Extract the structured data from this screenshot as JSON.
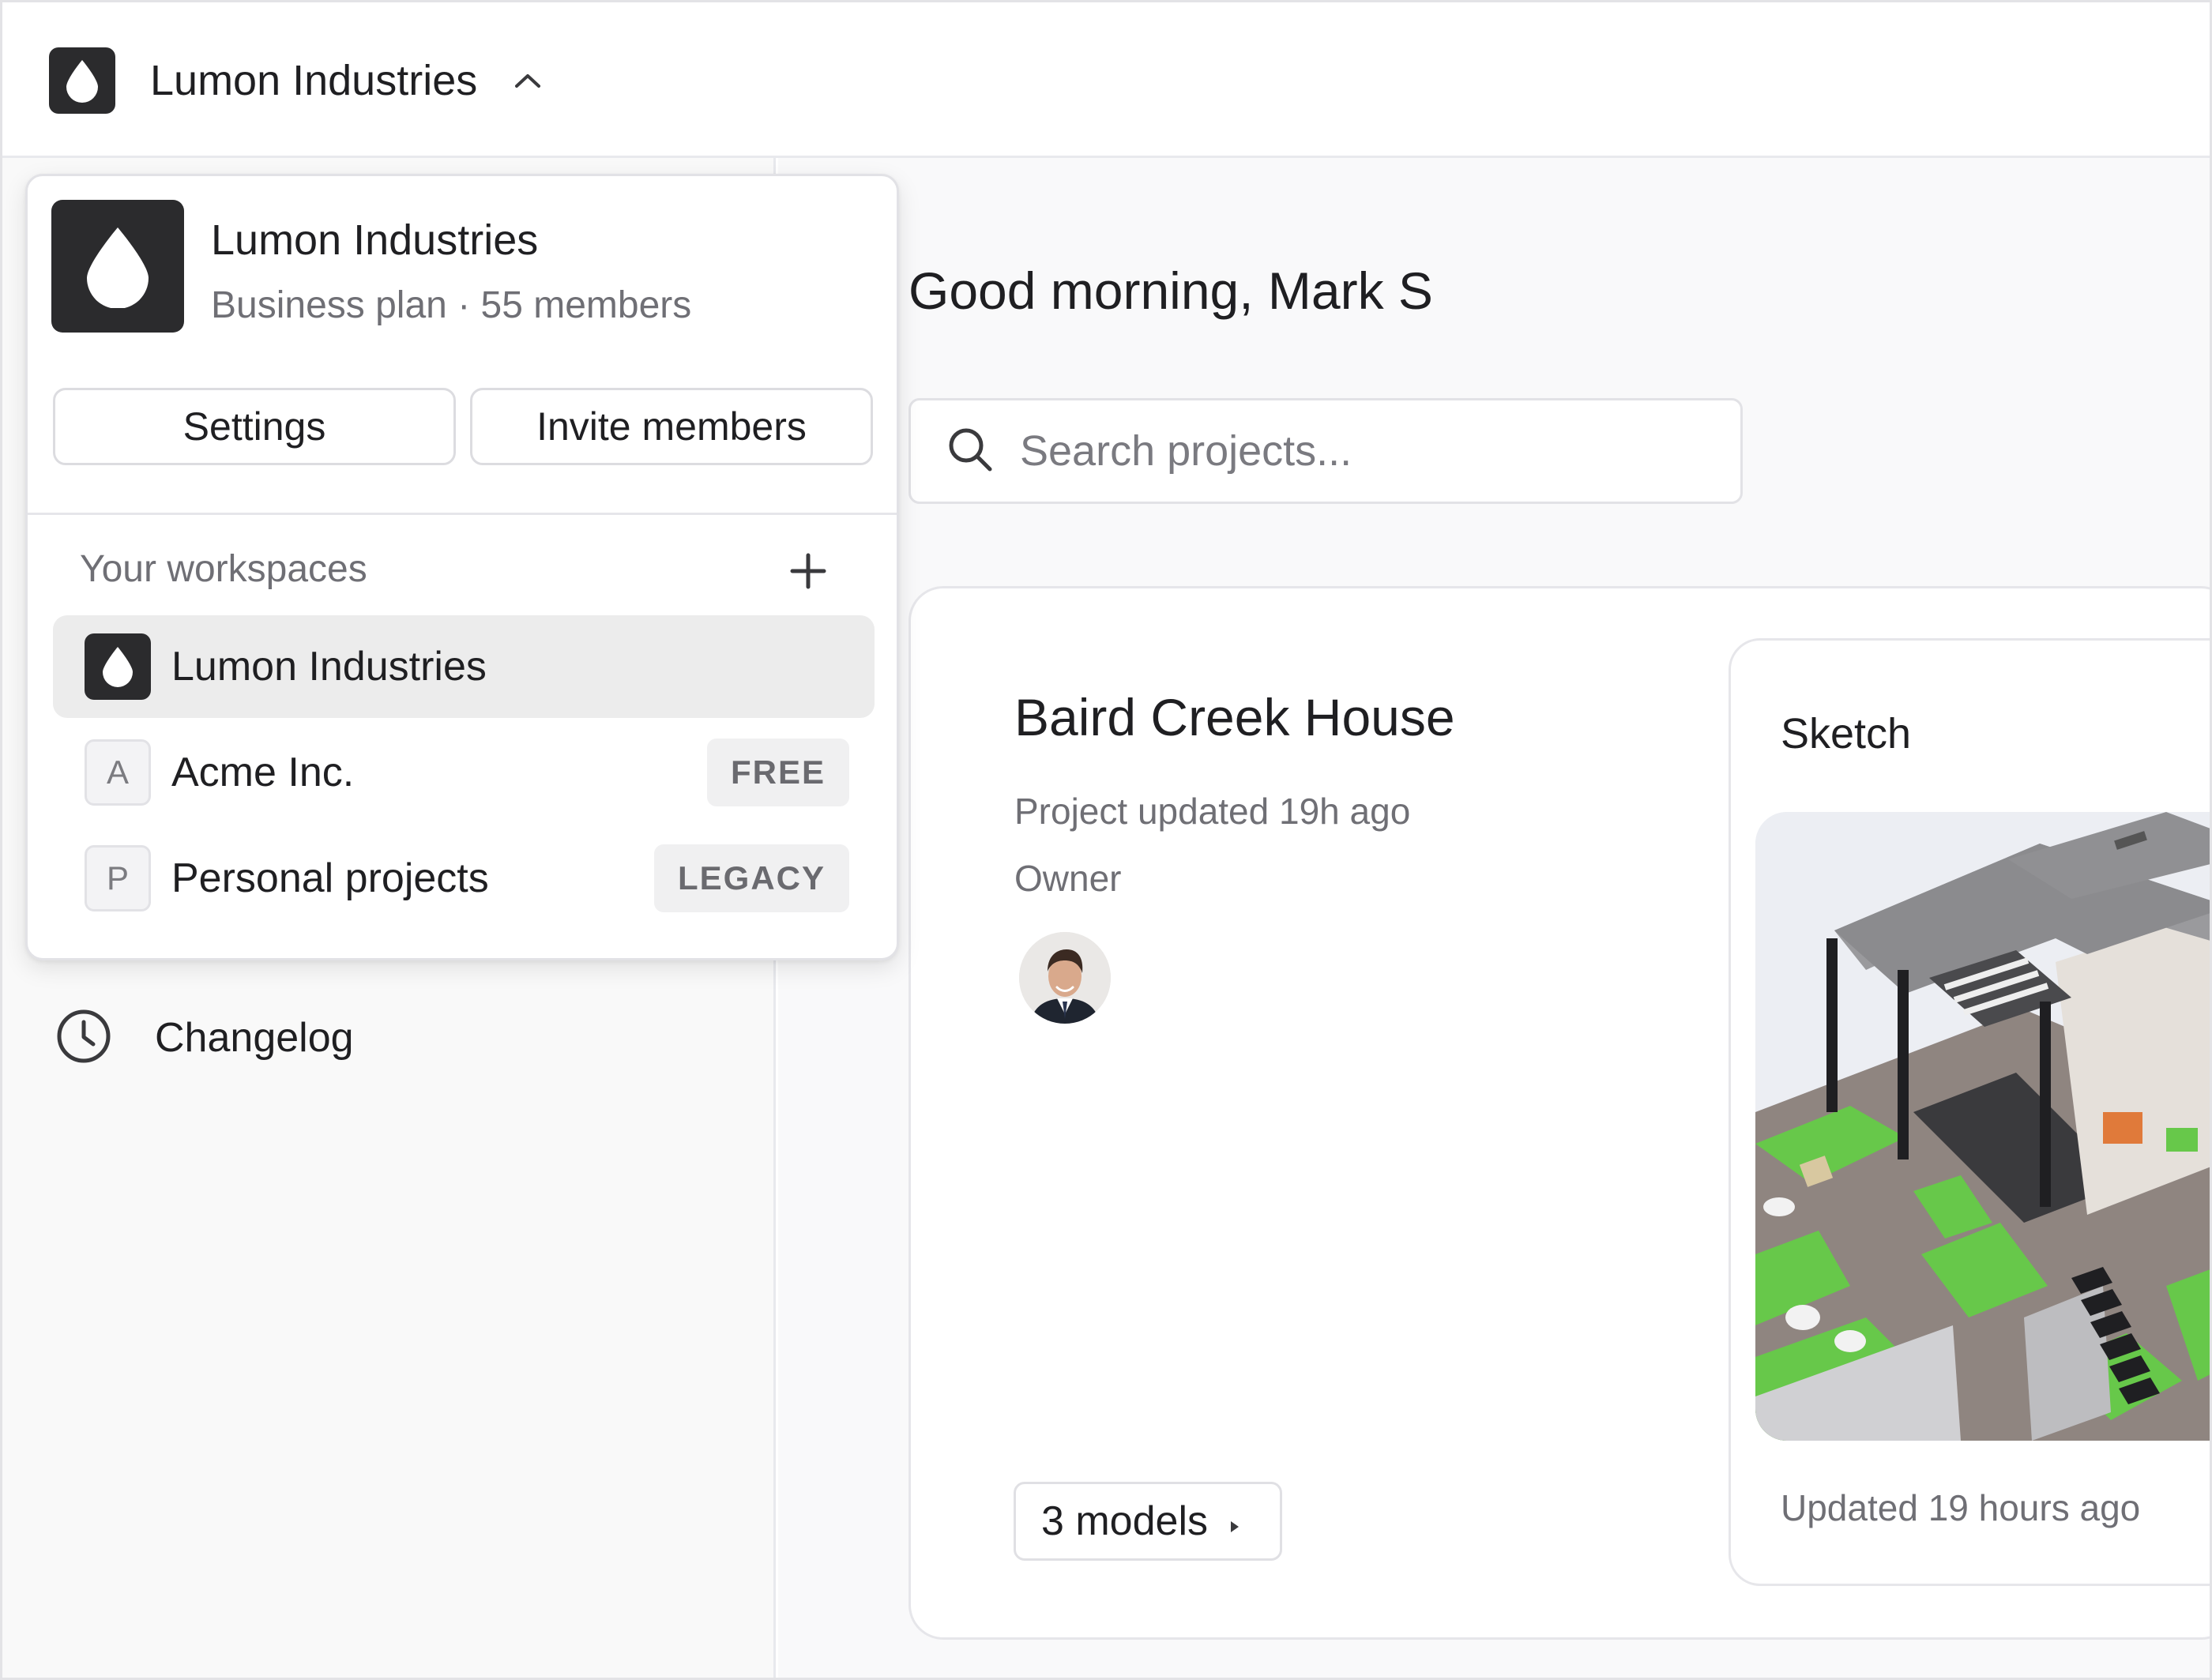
{
  "topbar": {
    "workspace_name": "Lumon Industries"
  },
  "popover": {
    "org_name": "Lumon Industries",
    "plan_line": "Business plan · 55 members",
    "settings_label": "Settings",
    "invite_label": "Invite members",
    "workspaces_header": "Your workspaces",
    "workspaces": [
      {
        "label": "Lumon Industries",
        "icon": "drop-logo",
        "badge": "",
        "active": true
      },
      {
        "label": "Acme Inc.",
        "icon_letter": "A",
        "badge": "FREE",
        "active": false
      },
      {
        "label": "Personal projects",
        "icon_letter": "P",
        "badge": "LEGACY",
        "active": false
      }
    ]
  },
  "sidebar": {
    "changelog_label": "Changelog"
  },
  "main": {
    "greeting": "Good morning, Mark S",
    "search_placeholder": "Search projects...",
    "project": {
      "title": "Baird Creek House",
      "updated": "Project updated 19h ago",
      "owner_label": "Owner",
      "models_label": "3 models",
      "model": {
        "name": "Sketch",
        "updated": "Updated 19 hours ago"
      }
    }
  },
  "colors": {
    "logo_bg": "#2b2b2d",
    "active_row_bg": "#ececec",
    "badge_bg": "#f0f0f1",
    "grass": "#67c84a"
  }
}
